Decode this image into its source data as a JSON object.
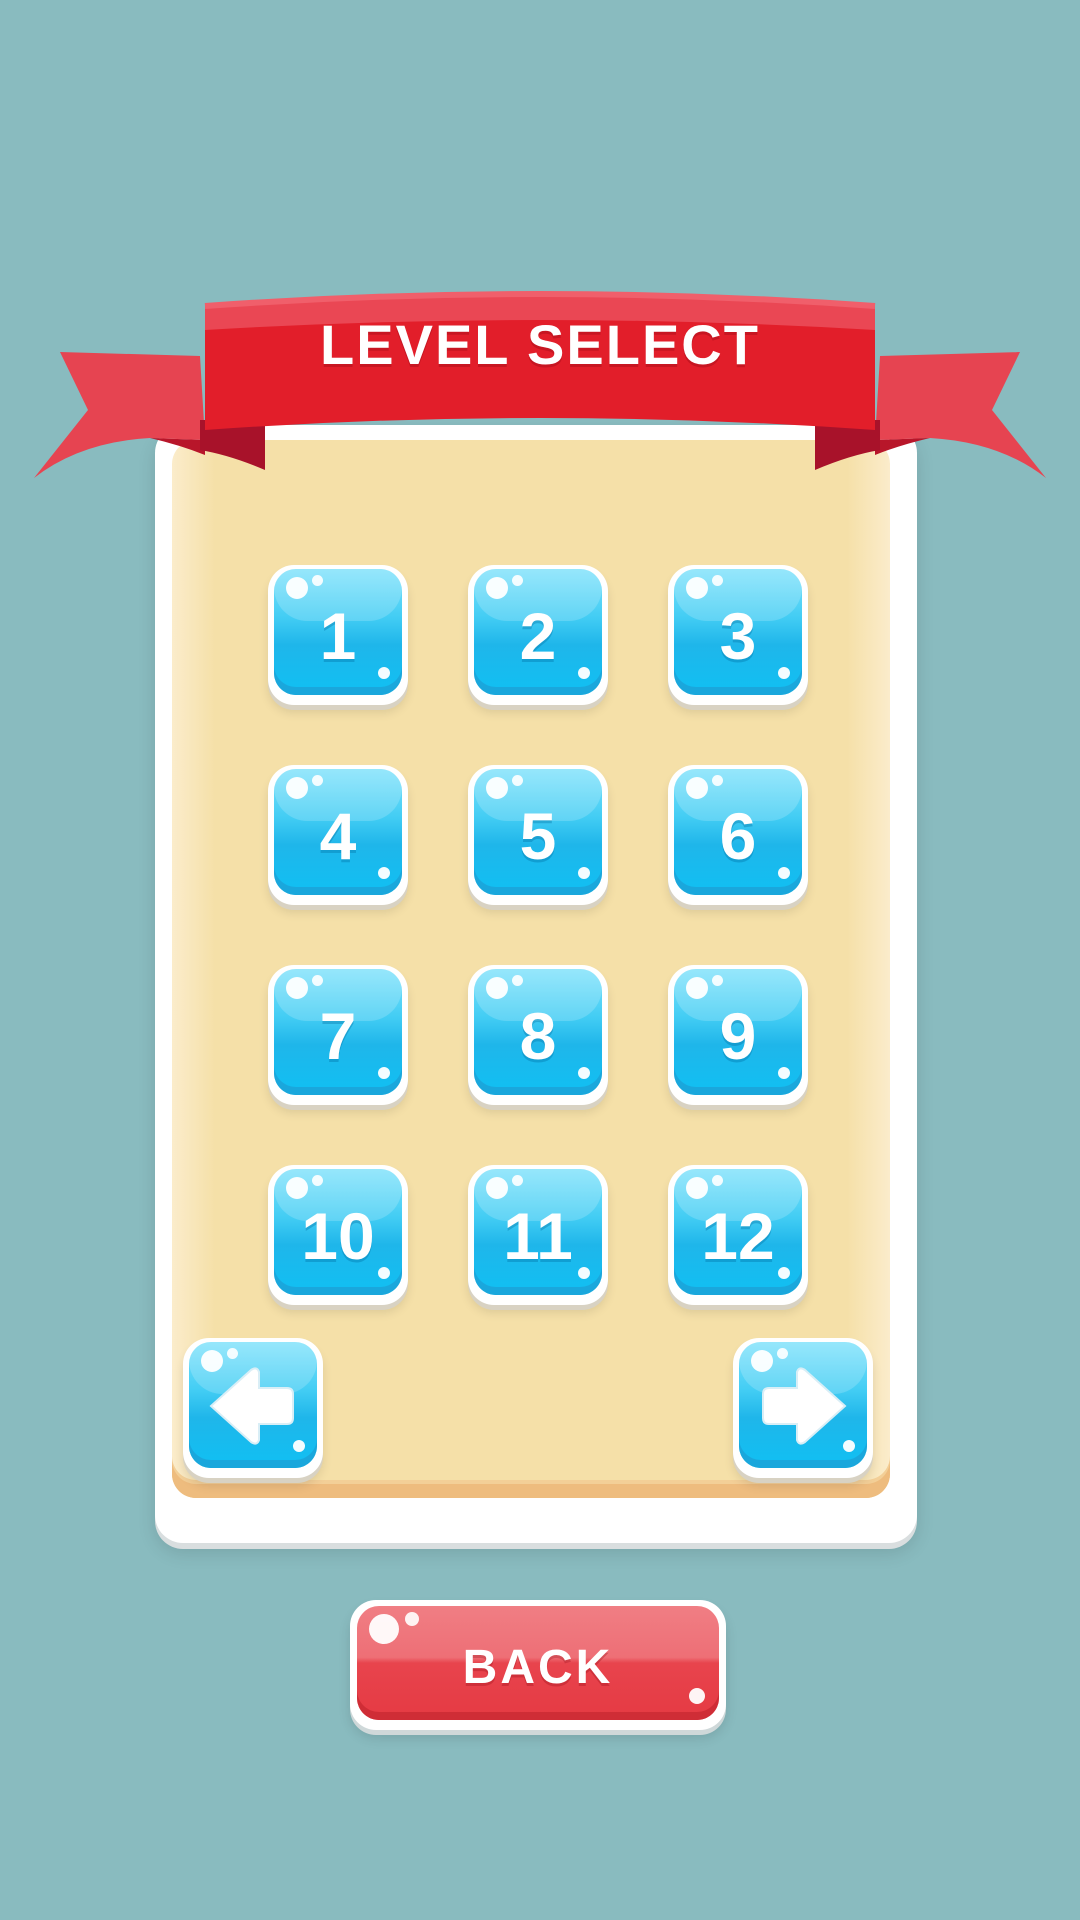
{
  "screen": {
    "title": "LEVEL SELECT",
    "background_color": "#89bbbf",
    "accent_red": "#e21e2a",
    "button_blue": "#1fb6ea"
  },
  "levels": [
    "1",
    "2",
    "3",
    "4",
    "5",
    "6",
    "7",
    "8",
    "9",
    "10",
    "11",
    "12"
  ],
  "navigation": {
    "prev_icon": "arrow-left-icon",
    "next_icon": "arrow-right-icon"
  },
  "back_button": {
    "label": "BACK"
  }
}
